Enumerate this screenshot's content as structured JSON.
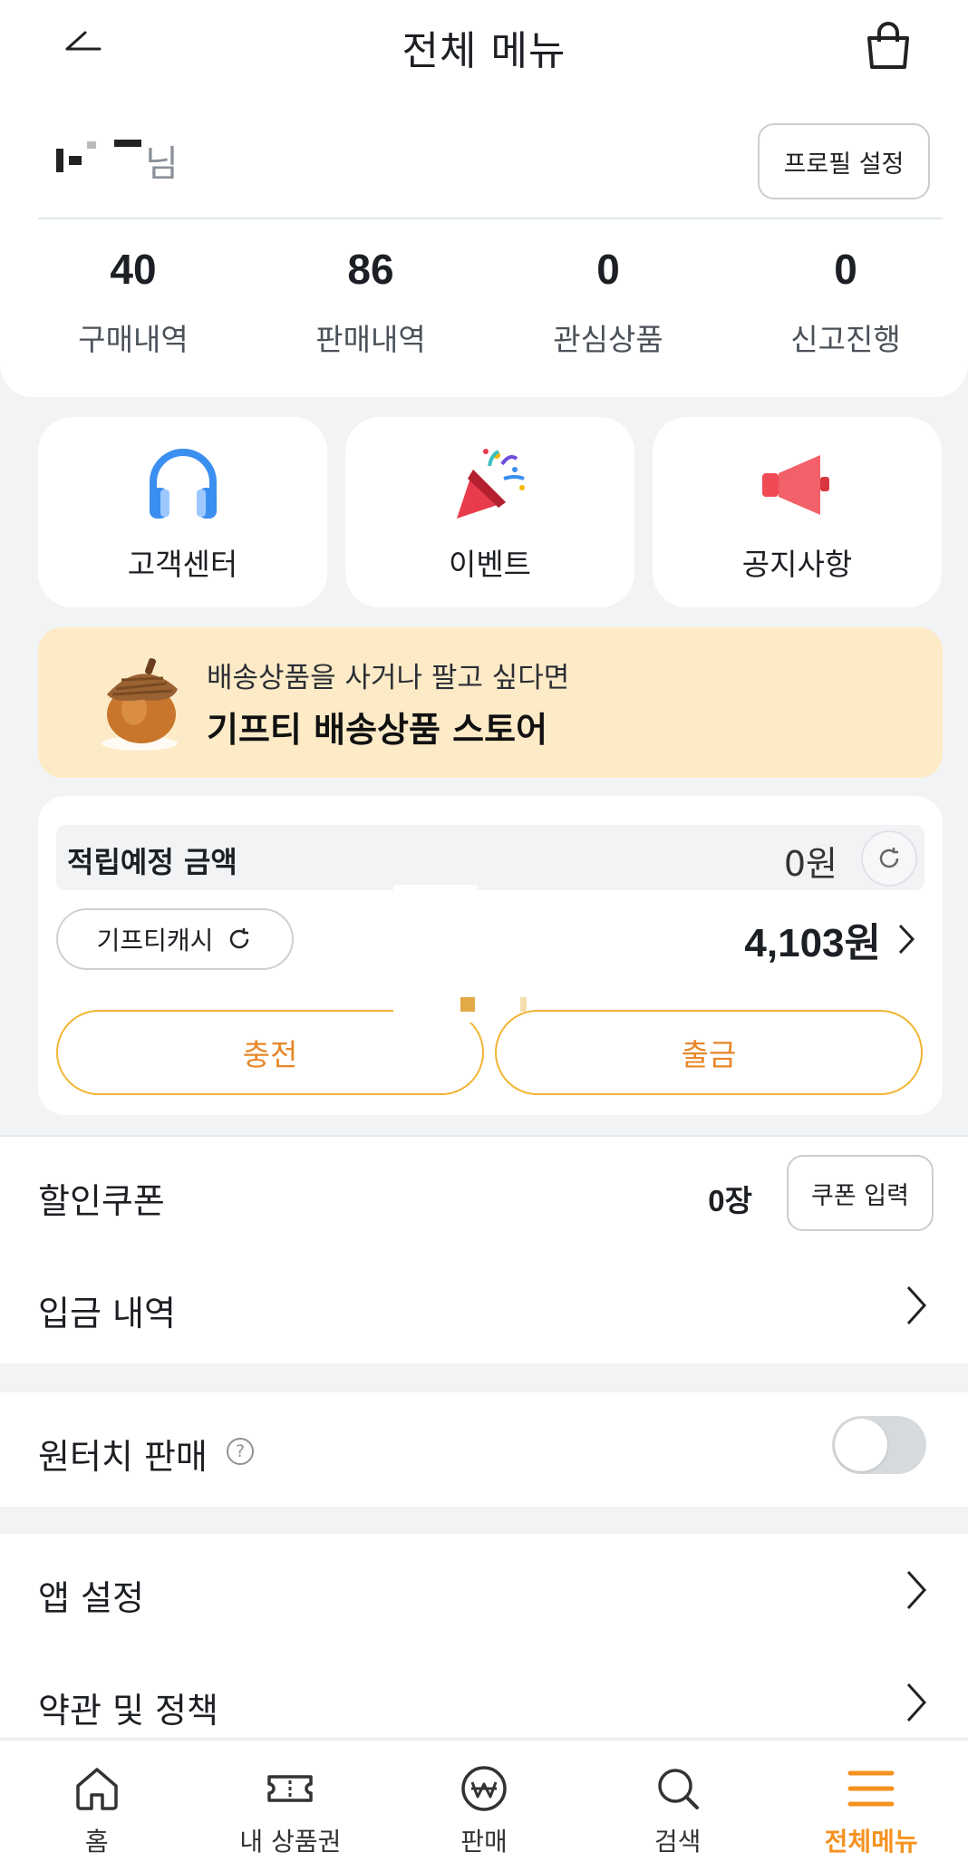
{
  "header": {
    "title": "전체 메뉴",
    "back_icon": "back-arrow-icon",
    "cart_icon": "shopping-bag-icon"
  },
  "profile": {
    "name_suffix": "님",
    "settings_button": "프로필 설정"
  },
  "stats": [
    {
      "value": "40",
      "label": "구매내역"
    },
    {
      "value": "86",
      "label": "판매내역"
    },
    {
      "value": "0",
      "label": "관심상품"
    },
    {
      "value": "0",
      "label": "신고진행"
    }
  ],
  "quick_menu": [
    {
      "label": "고객센터",
      "icon": "headphones-icon"
    },
    {
      "label": "이벤트",
      "icon": "party-popper-icon"
    },
    {
      "label": "공지사항",
      "icon": "megaphone-icon"
    }
  ],
  "banner": {
    "subtitle": "배송상품을 사거나 팔고 싶다면",
    "title": "기프티 배송상품 스토어",
    "icon": "acorn-icon"
  },
  "points": {
    "expected_label": "적립예정 금액",
    "expected_value": "0원",
    "cash_label": "기프티캐시",
    "cash_value": "4,103원",
    "charge_button": "충전",
    "withdraw_button": "출금"
  },
  "menu": {
    "coupon_label": "할인쿠폰",
    "coupon_count": "0장",
    "coupon_button": "쿠폰 입력",
    "deposit_label": "입금 내역",
    "onetouch_label": "원터치 판매",
    "onetouch_help": "?",
    "onetouch_enabled": false,
    "app_settings_label": "앱 설정",
    "terms_label": "약관 및 정책"
  },
  "bottom_nav": [
    {
      "label": "홈",
      "icon": "home-icon",
      "active": false
    },
    {
      "label": "내 상품권",
      "icon": "ticket-icon",
      "active": false
    },
    {
      "label": "판매",
      "icon": "won-coin-icon",
      "active": false
    },
    {
      "label": "검색",
      "icon": "search-icon",
      "active": false
    },
    {
      "label": "전체메뉴",
      "icon": "menu-icon",
      "active": true
    }
  ],
  "colors": {
    "accent": "#f5921f",
    "pill_border": "#f2b431",
    "banner_bg": "#fdebc8",
    "page_bg": "#f2f3f5"
  }
}
